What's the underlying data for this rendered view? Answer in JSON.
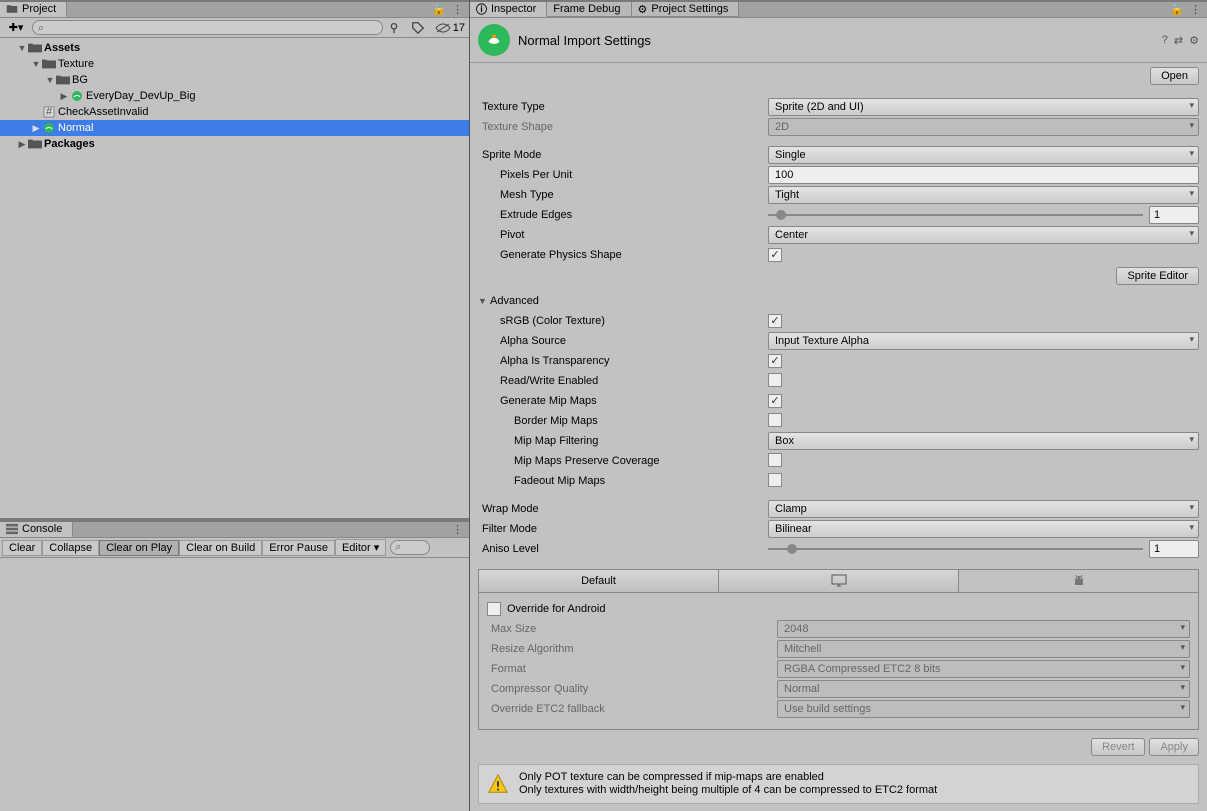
{
  "project": {
    "tab": "Project",
    "search_placeholder": "",
    "visibility_count": "17",
    "tree": {
      "assets": "Assets",
      "texture": "Texture",
      "bg": "BG",
      "everyday": "EveryDay_DevUp_Big",
      "check": "CheckAssetInvalid",
      "normal": "Normal",
      "packages": "Packages"
    }
  },
  "console": {
    "tab": "Console",
    "buttons": {
      "clear": "Clear",
      "collapse": "Collapse",
      "clear_on_play": "Clear on Play",
      "clear_on_build": "Clear on Build",
      "error_pause": "Error Pause",
      "editor": "Editor"
    }
  },
  "inspector": {
    "tabs": {
      "inspector": "Inspector",
      "frame_debug": "Frame Debug",
      "project_settings": "Project Settings"
    },
    "title": "Normal Import Settings",
    "open": "Open",
    "texture_type": {
      "label": "Texture Type",
      "value": "Sprite (2D and UI)"
    },
    "texture_shape": {
      "label": "Texture Shape",
      "value": "2D"
    },
    "sprite_mode": {
      "label": "Sprite Mode",
      "value": "Single"
    },
    "pixels_per_unit": {
      "label": "Pixels Per Unit",
      "value": "100"
    },
    "mesh_type": {
      "label": "Mesh Type",
      "value": "Tight"
    },
    "extrude_edges": {
      "label": "Extrude Edges",
      "value": "1"
    },
    "pivot": {
      "label": "Pivot",
      "value": "Center"
    },
    "generate_physics": {
      "label": "Generate Physics Shape"
    },
    "sprite_editor": "Sprite Editor",
    "advanced": "Advanced",
    "srgb": {
      "label": "sRGB (Color Texture)"
    },
    "alpha_source": {
      "label": "Alpha Source",
      "value": "Input Texture Alpha"
    },
    "alpha_trans": {
      "label": "Alpha Is Transparency"
    },
    "read_write": {
      "label": "Read/Write Enabled"
    },
    "gen_mip": {
      "label": "Generate Mip Maps"
    },
    "border_mip": {
      "label": "Border Mip Maps"
    },
    "mip_filter": {
      "label": "Mip Map Filtering",
      "value": "Box"
    },
    "mip_preserve": {
      "label": "Mip Maps Preserve Coverage"
    },
    "fadeout_mip": {
      "label": "Fadeout Mip Maps"
    },
    "wrap_mode": {
      "label": "Wrap Mode",
      "value": "Clamp"
    },
    "filter_mode": {
      "label": "Filter Mode",
      "value": "Bilinear"
    },
    "aniso": {
      "label": "Aniso Level",
      "value": "1"
    },
    "platform": {
      "default": "Default",
      "override": "Override for Android",
      "max_size": {
        "label": "Max Size",
        "value": "2048"
      },
      "resize": {
        "label": "Resize Algorithm",
        "value": "Mitchell"
      },
      "format": {
        "label": "Format",
        "value": "RGBA Compressed ETC2 8 bits"
      },
      "quality": {
        "label": "Compressor Quality",
        "value": "Normal"
      },
      "etc2": {
        "label": "Override ETC2 fallback",
        "value": "Use build settings"
      }
    },
    "revert": "Revert",
    "apply": "Apply",
    "warning": {
      "line1": "Only POT texture can be compressed if mip-maps are enabled",
      "line2": "Only textures with width/height being multiple of 4 can be compressed to ETC2 format"
    }
  }
}
